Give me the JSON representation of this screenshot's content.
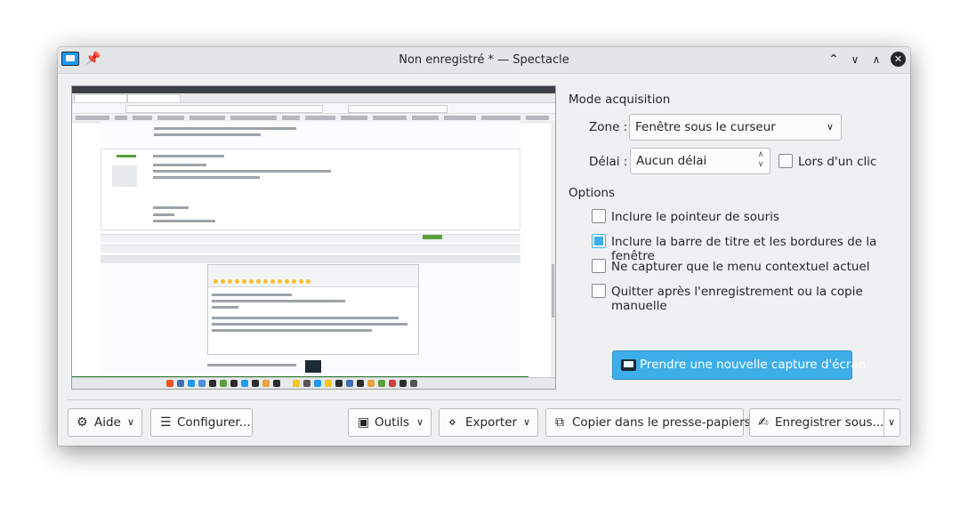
{
  "window": {
    "title": "Non enregistré * — Spectacle",
    "pin_icon": "pin-icon",
    "controls": [
      "keep-above-icon",
      "minimize-icon",
      "maximize-icon",
      "close-icon"
    ]
  },
  "preview": {
    "description_icon": "screenshot-preview"
  },
  "acquisition": {
    "heading": "Mode acquisition",
    "zone_label": "Zone :",
    "zone_value": "Fenêtre sous le curseur",
    "delay_label": "Délai :",
    "delay_value": "Aucun délai",
    "on_click_label": "Lors d'un clic",
    "on_click_checked": false
  },
  "options": {
    "heading": "Options",
    "items": [
      {
        "label": "Inclure le pointeur de souris",
        "checked": false
      },
      {
        "label": "Inclure la barre de titre et les bordures de la fenêtre",
        "checked": true
      },
      {
        "label": "Ne capturer que le menu contextuel actuel",
        "checked": false
      },
      {
        "label": "Quitter après l'enregistrement ou la copie manuelle",
        "checked": false
      }
    ]
  },
  "capture_button": {
    "label": "Prendre une nouvelle capture d'écran"
  },
  "footer": {
    "help": "Aide",
    "configure": "Configurer...",
    "tools": "Outils",
    "export": "Exporter",
    "copy": "Copier dans le presse-papiers",
    "save_as": "Enregistrer sous..."
  },
  "colors": {
    "accent": "#3daee9",
    "window_bg": "#eff0f1",
    "text": "#232629"
  }
}
